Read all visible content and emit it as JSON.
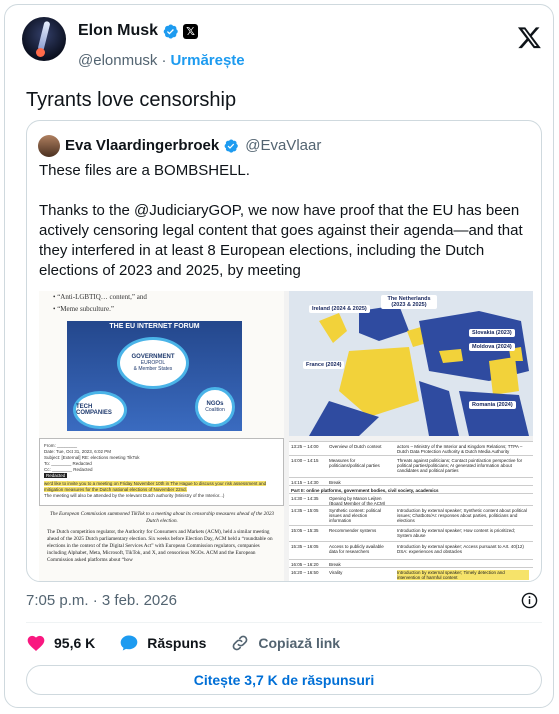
{
  "author": {
    "name": "Elon Musk",
    "handle": "@elonmusk",
    "separator": "·",
    "follow_label": "Urmărește",
    "affiliate_badge": "𝕏"
  },
  "tweet_text": "Tyrants love censorship",
  "quoted": {
    "name": "Eva Vlaardingerbroek",
    "handle": "@EvaVlaar",
    "paragraph1": "These files are a BOMBSHELL.",
    "paragraph2": "Thanks to the @JudiciaryGOP, we now have proof that the EU has been actively censoring legal content that goes against their agenda—and that they interfered in at least 8 European elections, including the Dutch elections of 2023 and 2025, by meeting",
    "image": {
      "left": {
        "bullets": [
          "• “Anti-LGBTIQ… content,” and",
          "• “Meme subculture.”"
        ],
        "forum_title": "THE EU INTERNET FORUM",
        "circles": [
          "GOVERNMENT",
          "TECH COMPANIES",
          "NGOs"
        ],
        "circle_sub": [
          "EUROPOL",
          "& Member States",
          "",
          "Coalition"
        ],
        "email_lines": [
          "From: ________",
          "Date: Tue, Oct 31, 2023, 6:02 PM",
          "Subject: [External] RE: elections meeting TikTok",
          "To: ________  Redacted",
          "Cc: ________  Redacted",
          "Redacted"
        ],
        "email_highlight": "we'd like to invite you to a meeting on Friday November 10th in The Hague to discuss your risk assessment and mitigation measures for the Dutch national elections of November 22nd.",
        "email_note": "The meeting will also be attended by the relevant Dutch authority (Ministry of the Interior...)",
        "caption": "The European Commission summoned TikTok to a meeting about its censorship measures ahead of the 2023 Dutch election.",
        "body": "The Dutch competition regulator, the Authority for Consumers and Markets (ACM), held a similar meeting ahead of the 2025 Dutch parliamentary election. Six weeks before Election Day, ACM held a “roundtable on elections in the context of the Digital Services Act” with European Commission regulators, companies including Alphabet, Meta, Microsoft, TikTok, and X, and censorious NGOs. ACM and the European Commission asked platforms about “how",
        "redacted": "Redacted"
      },
      "right": {
        "map_labels": [
          "Ireland (2024 & 2025)",
          "The Netherlands (2023 & 2025)",
          "Slovakia (2023)",
          "Moldova (2024)",
          "France (2024)",
          "Romania (2024)"
        ],
        "agenda": [
          {
            "time": "13:25 – 14:00",
            "item": "Overview of Dutch context",
            "notes": "actors – Ministry of the Interior and Kingdom Relations; TTPA – Dutch Data Protection Authority & Dutch Media Authority"
          },
          {
            "time": "14:00 – 14:15",
            "item": "Measures for politicians/political parties",
            "notes": "Threats against politicians; Contact point/action perspective for political parties/politicians; AI generated information about candidates and political parties"
          },
          {
            "time": "14:15 – 14:30",
            "item": "Break",
            "notes": ""
          },
          {
            "time": "",
            "item": "Part II: online platforms, government bodies, civil society, academics",
            "notes": ""
          },
          {
            "time": "14:30 – 14:35",
            "item": "Opening by Manon Leijten (Board Member of the ACM)",
            "notes": ""
          },
          {
            "time": "14:35 – 15:05",
            "item": "Synthetic content: political issues and election information",
            "notes": "Introduction by external speaker; Synthetic content about political issues; Chatbots/AI: responses about parties, politicians and elections"
          },
          {
            "time": "15:05 – 15:35",
            "item": "Recommender systems",
            "notes": "Introduction by external speaker; How content is prioritized; System abuse"
          },
          {
            "time": "15:35 – 16:05",
            "item": "Access to publicly available data for researchers",
            "notes": "Introduction by external speaker; Access pursuant to Art. 40(12) DSA: experiences and obstacles"
          },
          {
            "time": "16:05 – 16:20",
            "item": "Break",
            "notes": ""
          },
          {
            "time": "16:20 – 16:50",
            "item": "Virality",
            "notes": "Introduction by external speaker; Timely detection and intervention of harmful content"
          }
        ]
      }
    }
  },
  "meta": {
    "time": "7:05 p.m.",
    "sep": "·",
    "date": "3 feb. 2026"
  },
  "actions": {
    "likes": "95,6 K",
    "reply_label": "Răspuns",
    "copy_link_label": "Copiază link"
  },
  "read_replies_label": "Citește 3,7 K de răspunsuri",
  "colors": {
    "accent": "#1d9bf0",
    "like": "#f91880",
    "muted": "#536471",
    "border": "#cfd9de"
  }
}
